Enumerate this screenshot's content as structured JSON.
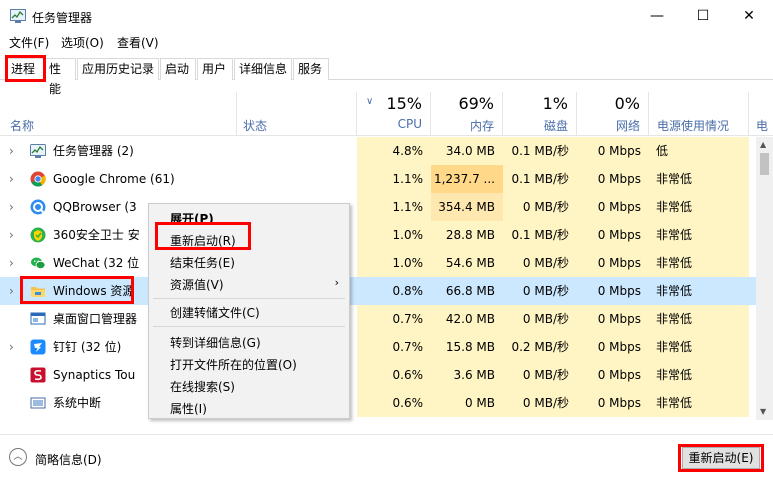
{
  "window": {
    "title": "任务管理器",
    "minimize_glyph": "—",
    "maximize_glyph": "☐",
    "close_glyph": "✕"
  },
  "menu": [
    "文件(F)",
    "选项(O)",
    "查看(V)"
  ],
  "tabs": [
    "进程",
    "性能",
    "应用历史记录",
    "启动",
    "用户",
    "详细信息",
    "服务"
  ],
  "columns": {
    "name": "名称",
    "status": "状态",
    "cpu": {
      "pct": "15%",
      "label": "CPU"
    },
    "memory": {
      "pct": "69%",
      "label": "内存"
    },
    "disk": {
      "pct": "1%",
      "label": "磁盘"
    },
    "network": {
      "pct": "0%",
      "label": "网络"
    },
    "power": {
      "label": "电源使用情况"
    },
    "power_trend": {
      "label": "电"
    }
  },
  "rows": [
    {
      "name": "任务管理器 (2)",
      "cpu": "4.8%",
      "mem": "34.0 MB",
      "disk": "0.1 MB/秒",
      "net": "0 Mbps",
      "power": "低",
      "icon": "task-manager-icon"
    },
    {
      "name": "Google Chrome (61)",
      "cpu": "1.1%",
      "mem": "1,237.7 ...",
      "disk": "0.1 MB/秒",
      "net": "0 Mbps",
      "power": "非常低",
      "icon": "chrome-icon"
    },
    {
      "name": "QQBrowser (3",
      "cpu": "1.1%",
      "mem": "354.4 MB",
      "disk": "0 MB/秒",
      "net": "0 Mbps",
      "power": "非常低",
      "icon": "qqbrowser-icon"
    },
    {
      "name": "360安全卫士 安",
      "cpu": "1.0%",
      "mem": "28.8 MB",
      "disk": "0.1 MB/秒",
      "net": "0 Mbps",
      "power": "非常低",
      "icon": "360-security-icon"
    },
    {
      "name": "WeChat (32 位",
      "cpu": "1.0%",
      "mem": "54.6 MB",
      "disk": "0 MB/秒",
      "net": "0 Mbps",
      "power": "非常低",
      "icon": "wechat-icon"
    },
    {
      "name": "Windows 资源",
      "cpu": "0.8%",
      "mem": "66.8 MB",
      "disk": "0 MB/秒",
      "net": "0 Mbps",
      "power": "非常低",
      "icon": "explorer-folder-icon"
    },
    {
      "name": "桌面窗口管理器",
      "cpu": "0.7%",
      "mem": "42.0 MB",
      "disk": "0 MB/秒",
      "net": "0 Mbps",
      "power": "非常低",
      "icon": "dwm-icon"
    },
    {
      "name": "钉钉 (32 位)",
      "cpu": "0.7%",
      "mem": "15.8 MB",
      "disk": "0.2 MB/秒",
      "net": "0 Mbps",
      "power": "非常低",
      "icon": "dingtalk-icon"
    },
    {
      "name": "Synaptics Tou",
      "cpu": "0.6%",
      "mem": "3.6 MB",
      "disk": "0 MB/秒",
      "net": "0 Mbps",
      "power": "非常低",
      "icon": "synaptics-icon"
    },
    {
      "name": "系统中断",
      "cpu": "0.6%",
      "mem": "0 MB",
      "disk": "0 MB/秒",
      "net": "0 Mbps",
      "power": "非常低",
      "icon": "system-interrupt-icon"
    }
  ],
  "context_menu": {
    "expand": "展开(P)",
    "restart": "重新启动(R)",
    "end_task": "结束任务(E)",
    "resource_values": "资源值(V)",
    "create_dump": "创建转储文件(C)",
    "go_to_details": "转到详细信息(G)",
    "open_file_location": "打开文件所在的位置(O)",
    "search_online": "在线搜索(S)",
    "properties": "属性(I)",
    "submenu_arrow": "›"
  },
  "footer": {
    "fewer_details": "简略信息(D)",
    "restart_button": "重新启动(E)"
  },
  "colors": {
    "cpu_heat": "#fff4c4",
    "mem_heat_light": "#fff4c4",
    "mem_heat_strong": "#ffd88a",
    "selected_row": "#cce8ff",
    "highlight_box": "#ff0000",
    "header_label": "#4a6ea9"
  }
}
